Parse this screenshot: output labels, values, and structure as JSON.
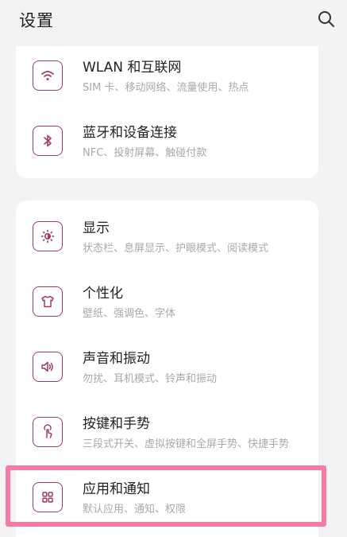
{
  "header": {
    "title": "设置"
  },
  "groups": [
    {
      "items": [
        {
          "title": "WLAN 和互联网",
          "subtitle": "SIM 卡、移动网络、流量使用、热点",
          "icon": "wifi-icon"
        },
        {
          "title": "蓝牙和设备连接",
          "subtitle": "NFC、投射屏幕、触碰付款",
          "icon": "bluetooth-icon"
        }
      ]
    },
    {
      "items": [
        {
          "title": "显示",
          "subtitle": "状态栏、息屏显示、护眼模式、阅读模式",
          "icon": "brightness-icon"
        },
        {
          "title": "个性化",
          "subtitle": "壁纸、强调色、字体",
          "icon": "tshirt-icon"
        },
        {
          "title": "声音和振动",
          "subtitle": "勿扰、耳机模式、铃声和振动",
          "icon": "speaker-icon"
        },
        {
          "title": "按键和手势",
          "subtitle": "三段式开关、虚拟按键和全屏手势、快捷手势",
          "icon": "gesture-icon"
        },
        {
          "title": "应用和通知",
          "subtitle": "默认应用、通知、权限",
          "icon": "apps-grid-icon"
        }
      ]
    }
  ],
  "colors": {
    "accent": "#a13a5e",
    "highlight": "#f57aa6",
    "background": "#f3f3f5"
  }
}
